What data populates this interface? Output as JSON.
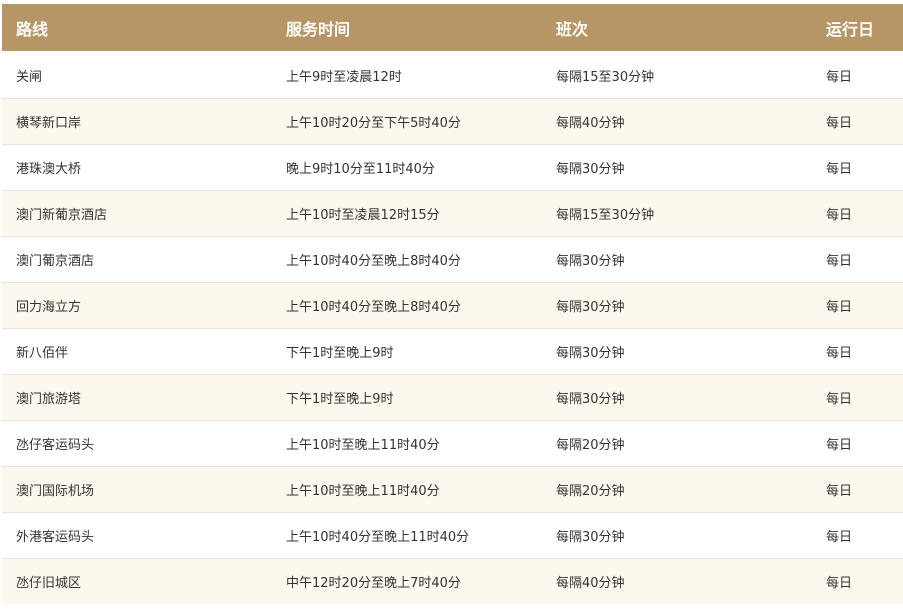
{
  "table": {
    "headers": [
      "路线",
      "服务时间",
      "班次",
      "运行日"
    ],
    "rows": [
      [
        "关闸",
        "上午9时至凌晨12时",
        "每隔15至30分钟",
        "每日"
      ],
      [
        "横琴新口岸",
        "上午10时20分至下午5时40分",
        "每隔40分钟",
        "每日"
      ],
      [
        "港珠澳大桥",
        "晚上9时10分至11时40分",
        "每隔30分钟",
        "每日"
      ],
      [
        "澳门新葡京酒店",
        "上午10时至凌晨12时15分",
        "每隔15至30分钟",
        "每日"
      ],
      [
        "澳门葡京酒店",
        "上午10时40分至晚上8时40分",
        "每隔30分钟",
        "每日"
      ],
      [
        "回力海立方",
        "上午10时40分至晚上8时40分",
        "每隔30分钟",
        "每日"
      ],
      [
        "新八佰伴",
        "下午1时至晚上9时",
        "每隔30分钟",
        "每日"
      ],
      [
        "澳门旅游塔",
        "下午1时至晚上9时",
        "每隔30分钟",
        "每日"
      ],
      [
        "氹仔客运码头",
        "上午10时至晚上11时40分",
        "每隔20分钟",
        "每日"
      ],
      [
        "澳门国际机场",
        "上午10时至晚上11时40分",
        "每隔20分钟",
        "每日"
      ],
      [
        "外港客运码头",
        "上午10时40分至晚上11时40分",
        "每隔30分钟",
        "每日"
      ],
      [
        "氹仔旧城区",
        "中午12时20分至晚上7时40分",
        "每隔40分钟",
        "每日"
      ]
    ]
  },
  "colors": {
    "header_bg": "#b69566",
    "header_text": "#ffffff",
    "row_alt_bg": "#fdf8ed",
    "row_bg": "#ffffff",
    "cell_text": "#333333"
  }
}
